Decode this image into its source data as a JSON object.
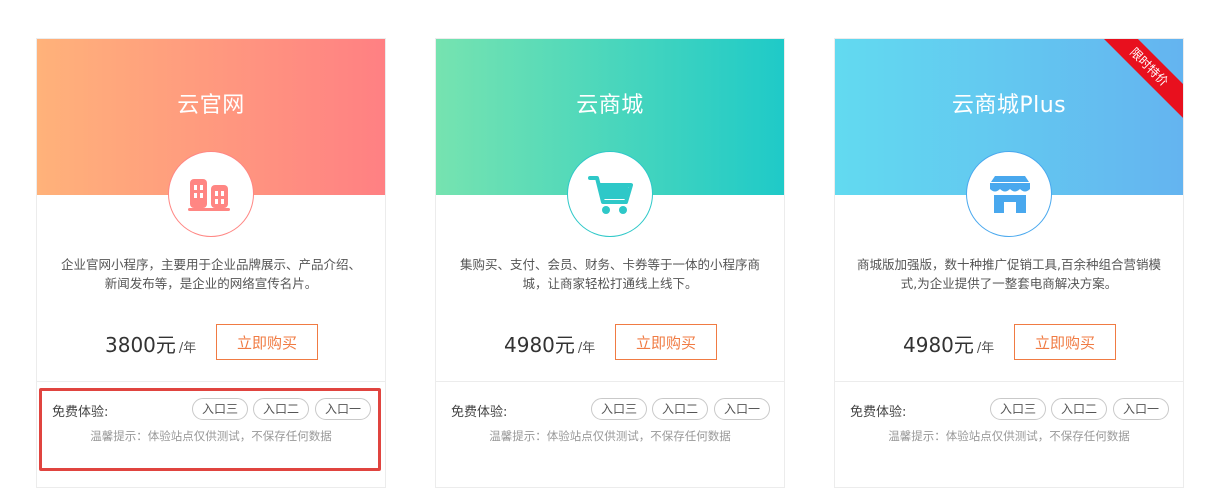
{
  "cards": [
    {
      "title": "云官网",
      "description": "企业官网小程序，主要用于企业品牌展示、产品介绍、新闻发布等，是企业的网络宣传名片。",
      "price": "3800元",
      "price_unit": "/年",
      "buy_label": "立即购买",
      "trial_label": "免费体验:",
      "entries": [
        "入口三",
        "入口二",
        "入口一"
      ],
      "tip": "温馨提示：体验站点仅供测试，不保存任何数据",
      "icon": "building-icon",
      "gradient": [
        "#ffb27a",
        "#ff8083"
      ],
      "accent": "#ff8683"
    },
    {
      "title": "云商城",
      "description": "集购买、支付、会员、财务、卡券等于一体的小程序商城，让商家轻松打通线上线下。",
      "price": "4980元",
      "price_unit": "/年",
      "buy_label": "立即购买",
      "trial_label": "免费体验:",
      "entries": [
        "入口三",
        "入口二",
        "入口一"
      ],
      "tip": "温馨提示：体验站点仅供测试，不保存任何数据",
      "icon": "shopping-cart-icon",
      "gradient": [
        "#76e3b0",
        "#1fcac8"
      ],
      "accent": "#2ec8c8"
    },
    {
      "title": "云商城Plus",
      "description": "商城版加强版，数十种推广促销工具,百余种组合营销模式,为企业提供了一整套电商解决方案。",
      "price": "4980元",
      "price_unit": "/年",
      "buy_label": "立即购买",
      "trial_label": "免费体验:",
      "entries": [
        "入口三",
        "入口二",
        "入口一"
      ],
      "tip": "温馨提示：体验站点仅供测试，不保存任何数据",
      "icon": "storefront-icon",
      "gradient": [
        "#62daf0",
        "#64b4f0"
      ],
      "accent": "#49a8ee",
      "ribbon": "限时特价"
    }
  ],
  "colors": {
    "buy_button": "#f07b43",
    "highlight": "#e0443f",
    "ribbon": "#e8101e"
  }
}
